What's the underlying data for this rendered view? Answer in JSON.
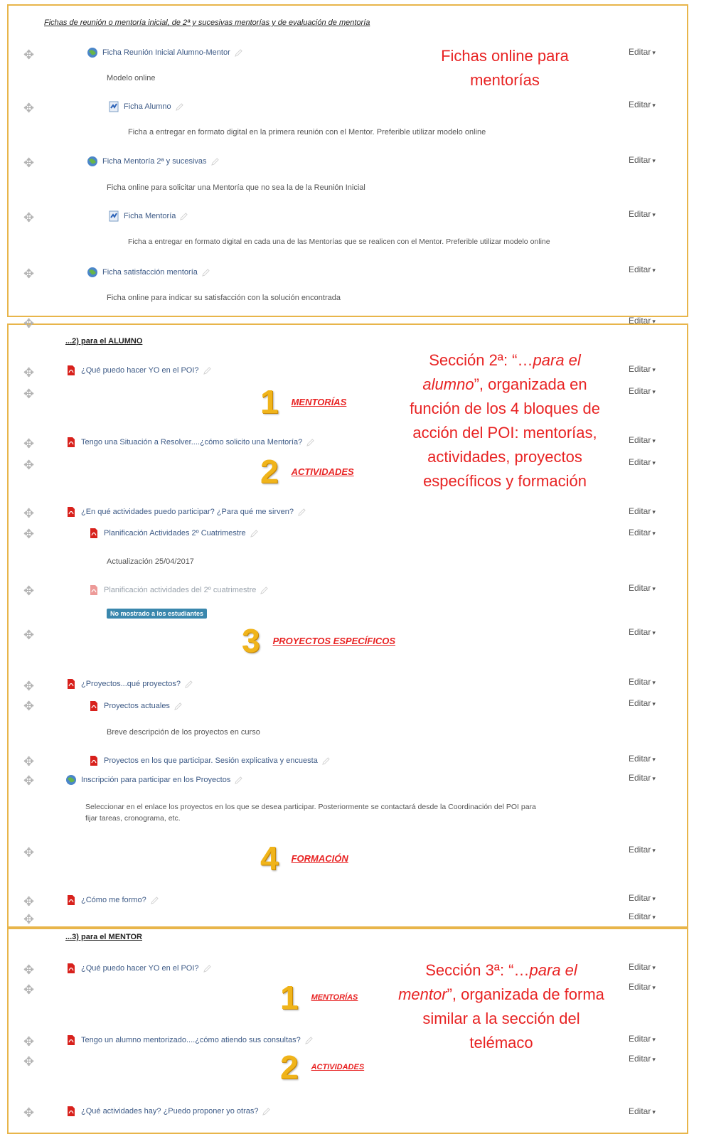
{
  "colors": {
    "panel_border": "#e8b54a",
    "annotation": "#e82323",
    "edit": "#555555",
    "badge_bg": "#3a87ad"
  },
  "icons": {
    "move": "move-arrows-icon",
    "url": "globe-link-icon",
    "doc": "document-icon",
    "pdf": "pdf-icon",
    "edit": "pencil-icon"
  },
  "edit_label": "Editar",
  "section1": {
    "header": "Fichas de reunión o mentoría inicial, de 2ª y sucesivas mentorías y de evaluación de mentoría",
    "annotation": "Fichas online para mentorías",
    "items": [
      {
        "label": "Ficha Reunión Inicial Alumno-Mentor",
        "icon": "url"
      },
      {
        "desc": "Modelo online"
      },
      {
        "label": "Ficha Alumno",
        "icon": "doc"
      },
      {
        "desc": "Ficha a entregar en formato digital en la primera reunión con el Mentor. Preferible utilizar modelo online"
      },
      {
        "label": "Ficha Mentoría 2ª y sucesivas",
        "icon": "url"
      },
      {
        "desc": "Ficha online para solicitar una Mentoría que no sea la de la Reunión Inicial"
      },
      {
        "label": "Ficha Mentoría",
        "icon": "doc"
      },
      {
        "desc": "Ficha a entregar en formato digital en cada una de las Mentorías que se realicen con el Mentor. Preferible utilizar modelo online"
      },
      {
        "label": "Ficha satisfacción mentoría",
        "icon": "url"
      },
      {
        "desc": "Ficha online para indicar su satisfacción con la solución encontrada"
      }
    ]
  },
  "section2": {
    "title": "...2) para el ALUMNO",
    "annotation_html_parts": [
      "Sección 2ª: “…",
      "para el alumno",
      "”, organizada en función de los 4 bloques de acción del POI: mentorías, actividades, proyectos específicos y formación"
    ],
    "items": [
      {
        "label": "¿Qué puedo hacer YO en el POI?"
      },
      {
        "cat_num": "1",
        "cat_label": "MENTORÍAS"
      },
      {
        "label": "Tengo una Situación a Resolver....¿cómo solicito una Mentoría?"
      },
      {
        "cat_num": "2",
        "cat_label": "ACTIVIDADES"
      },
      {
        "label": "¿En qué actividades puedo participar? ¿Para qué me sirven?"
      },
      {
        "label": "Planificación Actividades 2º Cuatrimestre"
      },
      {
        "desc": "Actualización 25/04/2017"
      },
      {
        "label": "Planificación actividades del 2º cuatrimestre"
      },
      {
        "badge": "No mostrado a los estudiantes"
      },
      {
        "cat_num": "3",
        "cat_label": "PROYECTOS ESPECÍFICOS"
      },
      {
        "label": "¿Proyectos...qué proyectos?"
      },
      {
        "label": "Proyectos actuales"
      },
      {
        "desc": "Breve descripción de los proyectos en curso"
      },
      {
        "label": "Proyectos en los que participar. Sesión explicativa y encuesta"
      },
      {
        "label": "Inscripción para participar en los Proyectos"
      },
      {
        "desc": "Seleccionar en el enlace los proyectos en los que se desea participar. Posteriormente se contactará desde la Coordinación del POI para"
      },
      {
        "desc": "fijar tareas, cronograma, etc."
      },
      {
        "cat_num": "4",
        "cat_label": "FORMACIÓN"
      },
      {
        "label": "¿Cómo me formo?"
      }
    ]
  },
  "section3": {
    "title": "...3) para el MENTOR",
    "items": [
      {
        "label": "¿Qué puedo hacer YO en el POI?"
      },
      {
        "cat_num": "1",
        "cat_label": "MENTORÍAS"
      },
      {
        "label": "Tengo un alumno mentorizado....¿cómo atiendo sus consultas?"
      },
      {
        "cat_num": "2",
        "cat_label": "ACTIVIDADES"
      },
      {
        "label": "¿Qué actividades hay? ¿Puedo proponer yo otras?"
      }
    ]
  }
}
